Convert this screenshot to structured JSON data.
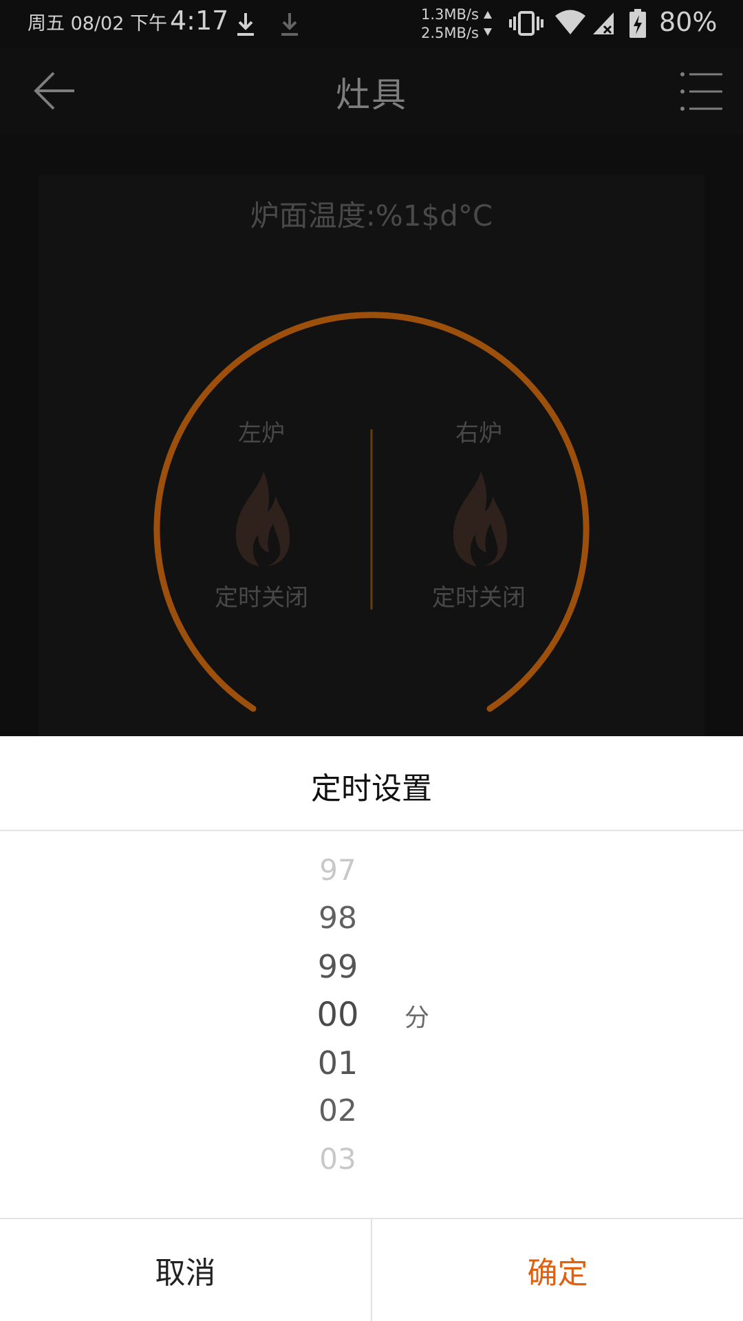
{
  "status_bar": {
    "date": "周五 08/02 下午",
    "time": "4:17",
    "net_up": "1.3MB/s",
    "net_down": "2.5MB/s",
    "battery": "80%"
  },
  "app_bar": {
    "title": "灶具"
  },
  "stove": {
    "temperature_label": "炉面温度:%1$d°C",
    "left_burner": {
      "name": "左炉",
      "status": "定时关闭"
    },
    "right_burner": {
      "name": "右炉",
      "status": "定时关闭"
    }
  },
  "timer_sheet": {
    "title": "定时设置",
    "unit": "分",
    "selected": "00",
    "minutes": [
      "97",
      "98",
      "99",
      "00",
      "01",
      "02",
      "03"
    ],
    "cancel_label": "取消",
    "confirm_label": "确定"
  },
  "colors": {
    "accent": "#e0600f",
    "dial_ring": "#c0620f",
    "flame": "#3a2a24"
  }
}
